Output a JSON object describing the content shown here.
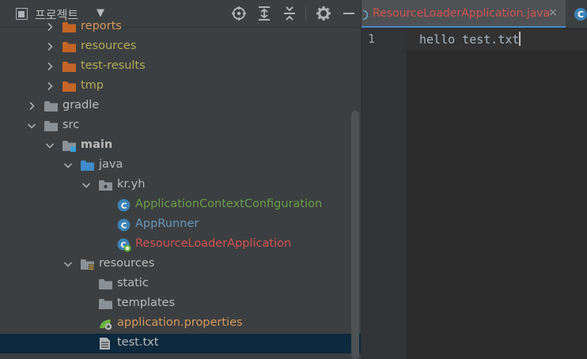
{
  "project_panel": {
    "title": "프로젝트",
    "toolbar": [
      "locate-icon",
      "expand-all-icon",
      "collapse-all-icon",
      "gear-icon",
      "minimize-icon"
    ]
  },
  "tree": [
    {
      "label": "reports",
      "depth": 2,
      "arrow": "right",
      "icon": "folder-orange",
      "color": "orange"
    },
    {
      "label": "resources",
      "depth": 2,
      "arrow": "right",
      "icon": "folder-orange",
      "color": "yellow"
    },
    {
      "label": "test-results",
      "depth": 2,
      "arrow": "right",
      "icon": "folder-orange",
      "color": "yellow"
    },
    {
      "label": "tmp",
      "depth": 2,
      "arrow": "right",
      "icon": "folder-orange",
      "color": "yellow"
    },
    {
      "label": "gradle",
      "depth": 1,
      "arrow": "right",
      "icon": "folder-gray",
      "color": "default"
    },
    {
      "label": "src",
      "depth": 1,
      "arrow": "down",
      "icon": "folder-gray",
      "color": "default"
    },
    {
      "label": "main",
      "depth": 2,
      "arrow": "down",
      "icon": "folder-module",
      "color": "default",
      "bold": true
    },
    {
      "label": "java",
      "depth": 3,
      "arrow": "down",
      "icon": "folder-blue",
      "color": "default"
    },
    {
      "label": "kr.yh",
      "depth": 4,
      "arrow": "down",
      "icon": "package",
      "color": "default"
    },
    {
      "label": "ApplicationContextConfiguration",
      "depth": 5,
      "arrow": "none",
      "icon": "class",
      "color": "green"
    },
    {
      "label": "AppRunner",
      "depth": 5,
      "arrow": "none",
      "icon": "class",
      "color": "blue"
    },
    {
      "label": "ResourceLoaderApplication",
      "depth": 5,
      "arrow": "none",
      "icon": "class-spring",
      "color": "red"
    },
    {
      "label": "resources",
      "depth": 3,
      "arrow": "down",
      "icon": "folder-resources",
      "color": "default"
    },
    {
      "label": "static",
      "depth": 4,
      "arrow": "none",
      "icon": "folder-gray",
      "color": "default"
    },
    {
      "label": "templates",
      "depth": 4,
      "arrow": "none",
      "icon": "folder-gray",
      "color": "default"
    },
    {
      "label": "application.properties",
      "depth": 4,
      "arrow": "none",
      "icon": "properties",
      "color": "orange"
    },
    {
      "label": "test.txt",
      "depth": 4,
      "arrow": "none",
      "icon": "text-file",
      "color": "default",
      "selected": true
    }
  ],
  "editor": {
    "tabs": [
      {
        "label": "ResourceLoaderApplication.java",
        "close": "×"
      }
    ],
    "line_number": "1",
    "content": "hello test.txt"
  },
  "colors": {
    "orange": "#d39a5d",
    "yellow": "#b3ac58",
    "green": "#6a9e49",
    "blue": "#6897bb",
    "red": "#d25252",
    "default": "#bbbbbb",
    "selection": "#0d293e",
    "panel": "#3c3f41",
    "editor": "#2b2b2b"
  }
}
